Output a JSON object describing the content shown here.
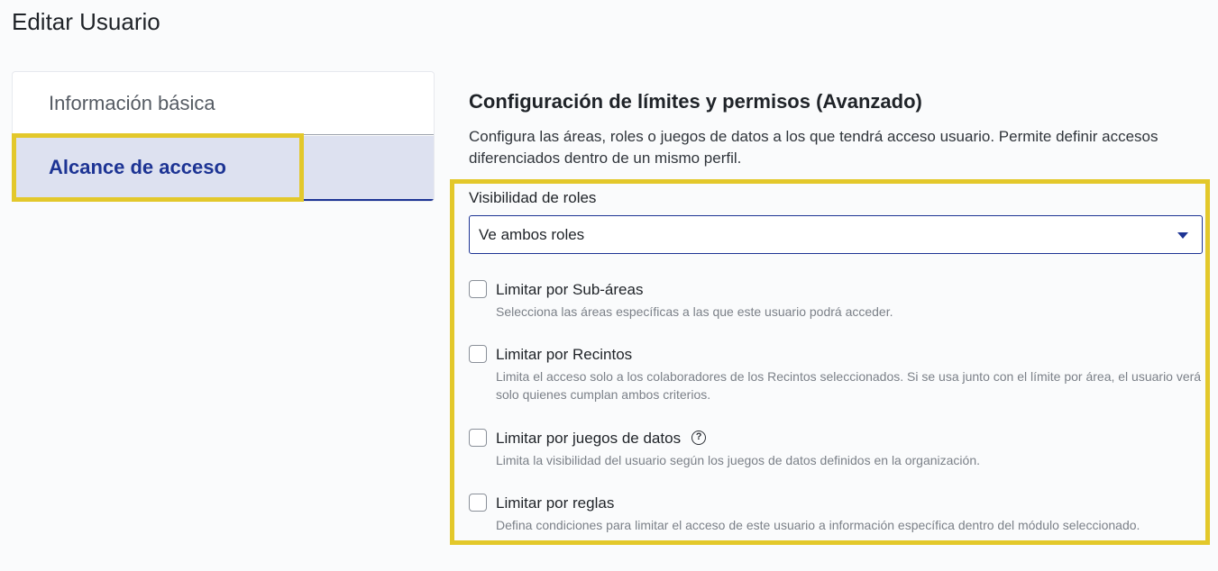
{
  "page": {
    "title": "Editar Usuario"
  },
  "sidebar": {
    "items": [
      {
        "label": "Información básica",
        "active": false
      },
      {
        "label": "Alcance de acceso",
        "active": true
      }
    ]
  },
  "section": {
    "title": "Configuración de límites y permisos (Avanzado)",
    "description": "Configura las áreas, roles o juegos de datos a los que tendrá acceso usuario. Permite definir accesos diferenciados dentro de un mismo perfil."
  },
  "visibility": {
    "label": "Visibilidad de roles",
    "selected": "Ve ambos roles"
  },
  "options": [
    {
      "label": "Limitar por Sub-áreas",
      "description": "Selecciona las áreas específicas a las que este usuario podrá acceder.",
      "checked": false
    },
    {
      "label": "Limitar por Recintos",
      "description": "Limita el acceso solo a los colaboradores de los Recintos seleccionados. Si se usa junto con el límite por área, el usuario verá solo quienes cumplan ambos criterios.",
      "checked": false
    },
    {
      "label": "Limitar por juegos de datos",
      "description": "Limita la visibilidad del usuario según los juegos de datos definidos en la organización.",
      "checked": false,
      "help_icon": "question-circle-icon"
    },
    {
      "label": "Limitar por reglas",
      "description": "Defina condiciones para limitar el acceso de este usuario a información específica dentro del módulo seleccionado.",
      "checked": false
    }
  ],
  "colors": {
    "accent": "#1d3494",
    "highlight": "#e3c82b",
    "active_bg": "#dde1f0"
  }
}
